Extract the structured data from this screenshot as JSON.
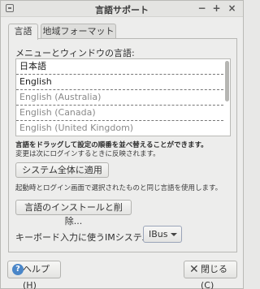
{
  "window": {
    "title": "言語サポート",
    "controls": {
      "minimize": "−",
      "maximize": "+",
      "close": "×"
    }
  },
  "tabs": [
    {
      "label": "言語",
      "active": true
    },
    {
      "label": "地域フォーマット",
      "active": false
    }
  ],
  "language_panel": {
    "list_heading": "メニューとウィンドウの言語:",
    "languages": [
      {
        "label": "日本語",
        "state": "primary"
      },
      {
        "label": "English",
        "state": "primary"
      },
      {
        "label": "English (Australia)",
        "state": "dim"
      },
      {
        "label": "English (Canada)",
        "state": "dim"
      },
      {
        "label": "English (United Kingdom)",
        "state": "dim"
      }
    ],
    "hint_bold": "言語をドラッグして設定の順番を並べ替えることができます。",
    "hint_normal": "変更は次にログインするときに反映されます。",
    "apply_button": "システム全体に適用",
    "apply_note": "起動時とログイン画面で選択されたものと同じ言語を使用します。",
    "install_button": "言語のインストールと削除...",
    "keyboard_label": "キーボード入力に使うIMシステム:",
    "keyboard_value": "IBus"
  },
  "footer": {
    "help_button": "ヘルプ(H)",
    "close_button": "閉じる(C)",
    "help_icon": "?"
  },
  "colors": {
    "window_bg": "#ededec",
    "list_bg": "#ffffff",
    "help_icon_bg": "#4a86c8"
  }
}
